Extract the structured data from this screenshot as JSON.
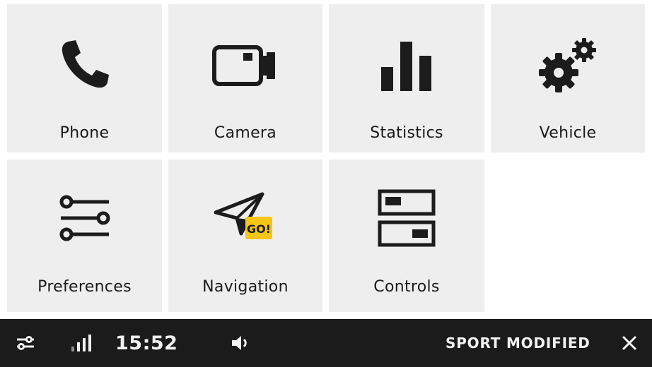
{
  "tiles": [
    {
      "label": "Phone",
      "icon": "phone-icon"
    },
    {
      "label": "Camera",
      "icon": "camera-icon"
    },
    {
      "label": "Statistics",
      "icon": "bar-chart-icon"
    },
    {
      "label": "Vehicle",
      "icon": "gears-icon"
    },
    {
      "label": "Preferences",
      "icon": "sliders-icon"
    },
    {
      "label": "Navigation",
      "icon": "navigation-arrow-icon",
      "badge": "GO!"
    },
    {
      "label": "Controls",
      "icon": "toggle-switches-icon"
    }
  ],
  "status_bar": {
    "time": "15:52",
    "mode": "SPORT MODIFIED",
    "icons": [
      "settings-sliders-icon",
      "signal-strength-icon",
      "volume-icon",
      "close-icon"
    ]
  },
  "colors": {
    "tile_bg": "#eeeeee",
    "bar_bg": "#1b1b1b",
    "badge_bg": "#f5c518",
    "icon": "#1c1c1c"
  }
}
